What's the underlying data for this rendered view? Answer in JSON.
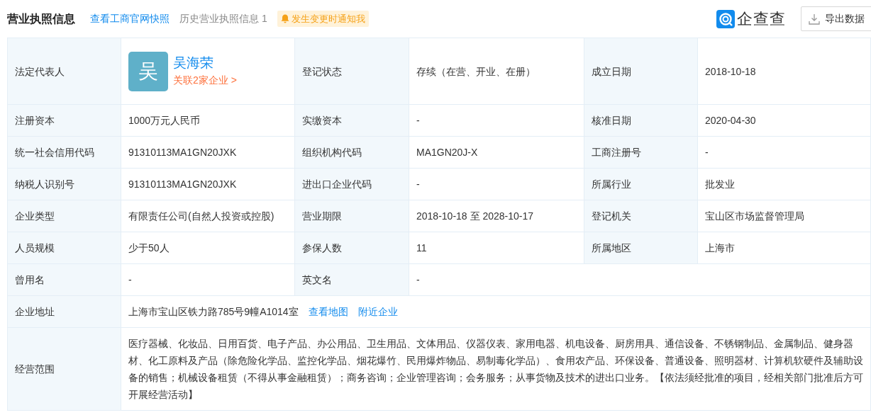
{
  "header": {
    "title": "营业执照信息",
    "snapshot_link": "查看工商官网快照",
    "history": {
      "label": "历史营业执照信息",
      "count": "1"
    },
    "notify_button": "发生变更时通知我",
    "logo": "企查查",
    "export_button": "导出数据"
  },
  "rows": [
    {
      "cells": [
        {
          "kind": "label",
          "text": "法定代表人"
        },
        {
          "kind": "person",
          "avatar": "吴",
          "name": "吴海荣",
          "related": "关联2家企业 >"
        },
        {
          "kind": "label",
          "text": "登记状态"
        },
        {
          "kind": "value",
          "text": "存续（在营、开业、在册）"
        },
        {
          "kind": "label",
          "text": "成立日期"
        },
        {
          "kind": "value",
          "text": "2018-10-18"
        }
      ]
    },
    {
      "cells": [
        {
          "kind": "label",
          "text": "注册资本"
        },
        {
          "kind": "value",
          "text": "1000万元人民币"
        },
        {
          "kind": "label",
          "text": "实缴资本"
        },
        {
          "kind": "value",
          "text": "-"
        },
        {
          "kind": "label",
          "text": "核准日期"
        },
        {
          "kind": "value",
          "text": "2020-04-30"
        }
      ]
    },
    {
      "cells": [
        {
          "kind": "label",
          "text": "统一社会信用代码"
        },
        {
          "kind": "value",
          "text": "91310113MA1GN20JXK"
        },
        {
          "kind": "label",
          "text": "组织机构代码"
        },
        {
          "kind": "value",
          "text": "MA1GN20J-X"
        },
        {
          "kind": "label",
          "text": "工商注册号"
        },
        {
          "kind": "value",
          "text": "-"
        }
      ]
    },
    {
      "cells": [
        {
          "kind": "label",
          "text": "纳税人识别号"
        },
        {
          "kind": "value",
          "text": "91310113MA1GN20JXK"
        },
        {
          "kind": "label",
          "text": "进出口企业代码"
        },
        {
          "kind": "value",
          "text": "-"
        },
        {
          "kind": "label",
          "text": "所属行业"
        },
        {
          "kind": "value",
          "text": "批发业"
        }
      ]
    },
    {
      "cells": [
        {
          "kind": "label",
          "text": "企业类型"
        },
        {
          "kind": "value",
          "text": "有限责任公司(自然人投资或控股)"
        },
        {
          "kind": "label",
          "text": "营业期限"
        },
        {
          "kind": "value",
          "text": "2018-10-18 至 2028-10-17"
        },
        {
          "kind": "label",
          "text": "登记机关"
        },
        {
          "kind": "value",
          "text": "宝山区市场监督管理局"
        }
      ]
    },
    {
      "cells": [
        {
          "kind": "label",
          "text": "人员规模"
        },
        {
          "kind": "value",
          "text": "少于50人"
        },
        {
          "kind": "label",
          "text": "参保人数"
        },
        {
          "kind": "value",
          "text": "11"
        },
        {
          "kind": "label",
          "text": "所属地区"
        },
        {
          "kind": "value",
          "text": "上海市"
        }
      ]
    },
    {
      "cells": [
        {
          "kind": "label",
          "text": "曾用名"
        },
        {
          "kind": "value",
          "text": "-"
        },
        {
          "kind": "label",
          "text": "英文名"
        },
        {
          "kind": "value",
          "text": "-"
        }
      ]
    },
    {
      "cells": [
        {
          "kind": "label",
          "text": "企业地址"
        },
        {
          "kind": "address",
          "text": "上海市宝山区铁力路785号9幢A1014室",
          "links": [
            "查看地图",
            "附近企业"
          ]
        }
      ]
    },
    {
      "cells": [
        {
          "kind": "label",
          "text": "经营范围"
        },
        {
          "kind": "value",
          "text": "医疗器械、化妆品、日用百货、电子产品、办公用品、卫生用品、文体用品、仪器仪表、家用电器、机电设备、厨房用具、通信设备、不锈钢制品、金属制品、健身器材、化工原料及产品（除危险化学品、监控化学品、烟花爆竹、民用爆炸物品、易制毒化学品）、食用农产品、环保设备、普通设备、照明器材、计算机软硬件及辅助设备的销售；机械设备租赁（不得从事金融租赁）；商务咨询；企业管理咨询；会务服务；从事货物及技术的进出口业务。【依法须经批准的项目，经相关部门批准后方可开展经营活动】"
        }
      ]
    }
  ]
}
